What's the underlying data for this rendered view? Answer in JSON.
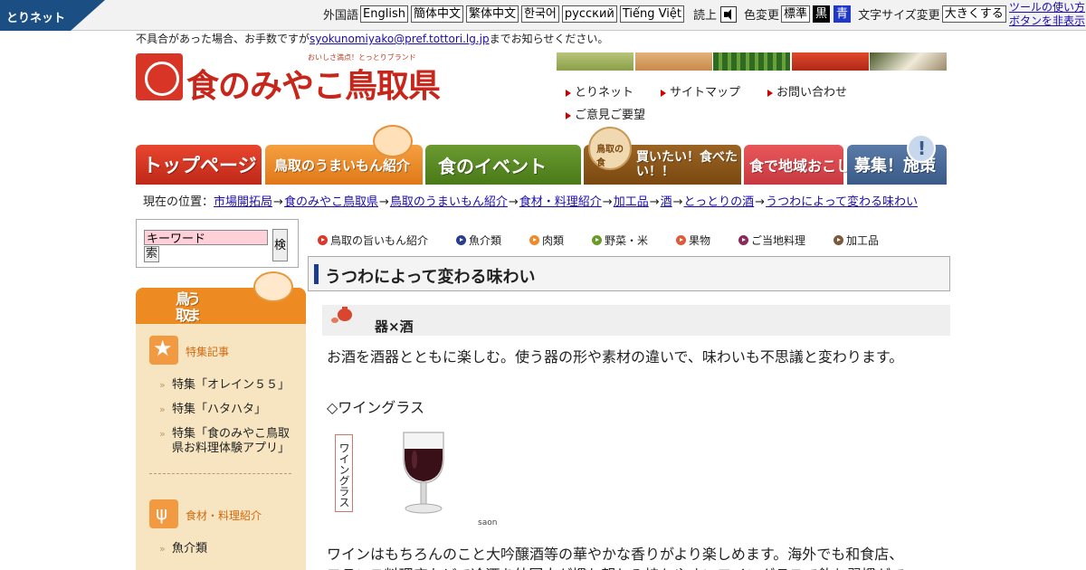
{
  "toolbar": {
    "logo": "とりネット",
    "foreign_label": "外国語",
    "languages": [
      "English",
      "簡体中文",
      "繁体中文",
      "한국어",
      "русский",
      "Tiếng Việt"
    ],
    "read_label": "読上",
    "color_label": "色変更",
    "color_options": [
      "標準",
      "黒",
      "青"
    ],
    "font_label": "文字サイズ変更",
    "font_button": "大きくする",
    "help_link": "ツールの使い方",
    "hide_link": "ボタンを非表示"
  },
  "notice": {
    "prefix": "不具合があった場合、お手数ですが",
    "email": "syokunomiyako@pref.tottori.lg.jp",
    "suffix": "までお知らせください。"
  },
  "logo": {
    "name": "食のみやこ鳥取県",
    "tagline": "おいしさ満点！とっとりブランド"
  },
  "header_links": [
    "とりネット",
    "サイトマップ",
    "お問い合わせ",
    "ご意見ご要望"
  ],
  "nav": [
    "トップページ",
    "鳥取のうまいもん紹介",
    "食のイベント",
    "買いたい！食べたい！！",
    "食で地域おこし",
    "募集！施策"
  ],
  "nav_badge": "鳥取の食",
  "breadcrumb": {
    "label": "現在の位置：",
    "items": [
      "市場開拓局",
      "食のみやこ鳥取県",
      "鳥取のうまいもん紹介",
      "食材・料理紹介",
      "加工品",
      "酒",
      "とっとりの酒",
      "うつわによって変わる味わい"
    ]
  },
  "search": {
    "placeholder": "キーワード",
    "button": "検索",
    "button_part1": "検",
    "button_part2": "索"
  },
  "sidebar": {
    "heading_line1": "鳥取の",
    "heading_line2": "うまいもん紹介",
    "section1": "特集記事",
    "section1_items": [
      "特集「オレイン５５」",
      "特集「ハタハタ」",
      "特集「食のみやこ鳥取県お料理体験アプリ」"
    ],
    "section2": "食材・料理紹介",
    "section2_items": [
      "魚介類"
    ]
  },
  "categories": [
    {
      "label": "鳥取の旨いもん紹介",
      "color": "#d9382a"
    },
    {
      "label": "魚介類",
      "color": "#2a3c8c"
    },
    {
      "label": "肉類",
      "color": "#f0892a"
    },
    {
      "label": "野菜・米",
      "color": "#6a9a2a"
    },
    {
      "label": "果物",
      "color": "#e05a3a"
    },
    {
      "label": "ご当地料理",
      "color": "#8a2a5a"
    },
    {
      "label": "加工品",
      "color": "#7a5a3a"
    }
  ],
  "page_title": "うつわによって変わる味わい",
  "content": {
    "section_title": "器×酒",
    "intro": "お酒を酒器とともに楽しむ。使う器の形や素材の違いで、味わいも不思議と変わります。",
    "subhead": "◇ワイングラス",
    "caption": "ワイングラス",
    "credit": "saon",
    "para_line1": "ワインはもちろんのこと大吟醸酒等の華やかな香りがより楽しめます。海外でも和食店、",
    "para_line2": "フランス料理店などで冷酒を外国人が慣れ親しみ持ちやすいワイングラスで飲む習慣がで"
  },
  "colors": {
    "toolbar_blue": "#1b4e82",
    "accent_red": "#d9382a",
    "orange": "#ed8a22",
    "green": "#5a8a2a",
    "brown": "#8a5418",
    "sidebar_bg": "#f7e5c1"
  }
}
